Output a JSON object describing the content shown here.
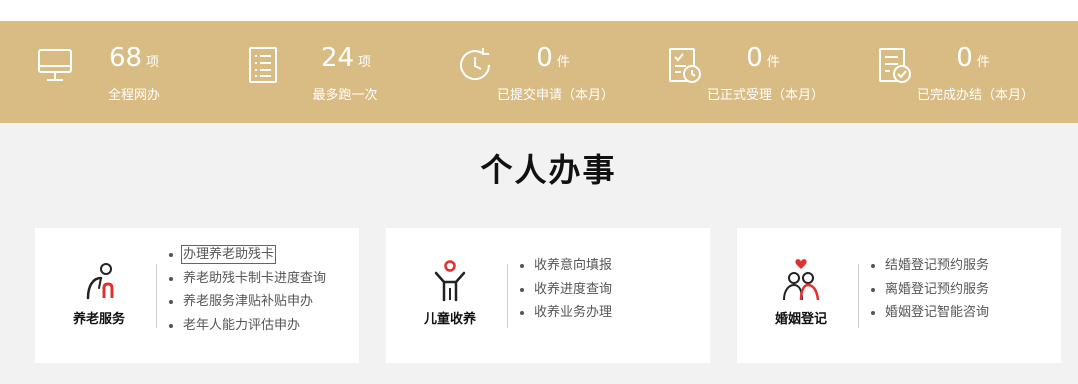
{
  "stats": [
    {
      "icon": "monitor-icon",
      "value": "68",
      "unit": "项",
      "label": "全程网办"
    },
    {
      "icon": "document-list-icon",
      "value": "24",
      "unit": "项",
      "label": "最多跑一次"
    },
    {
      "icon": "history-clock-icon",
      "value": "0",
      "unit": "件",
      "label": "已提交申请（本月）"
    },
    {
      "icon": "clipboard-time-icon",
      "value": "0",
      "unit": "件",
      "label": "已正式受理（本月）"
    },
    {
      "icon": "document-check-icon",
      "value": "0",
      "unit": "件",
      "label": "已完成办结（本月）"
    }
  ],
  "section": {
    "title": "个人办事"
  },
  "cards": [
    {
      "category": "养老服务",
      "icon": "elderly-person-icon",
      "items": [
        "办理养老助残卡",
        "养老助残卡制卡进度查询",
        "养老服务津贴补贴申办",
        "老年人能力评估申办"
      ]
    },
    {
      "category": "儿童收养",
      "icon": "child-icon",
      "items": [
        "收养意向填报",
        "收养进度查询",
        "收养业务办理"
      ]
    },
    {
      "category": "婚姻登记",
      "icon": "couple-heart-icon",
      "items": [
        "结婚登记预约服务",
        "离婚登记预约服务",
        "婚姻登记智能咨询"
      ]
    }
  ],
  "colors": {
    "stats_bg": "#d9bc84",
    "page_bg": "#f2f2f2",
    "accent_red": "#e03030"
  }
}
